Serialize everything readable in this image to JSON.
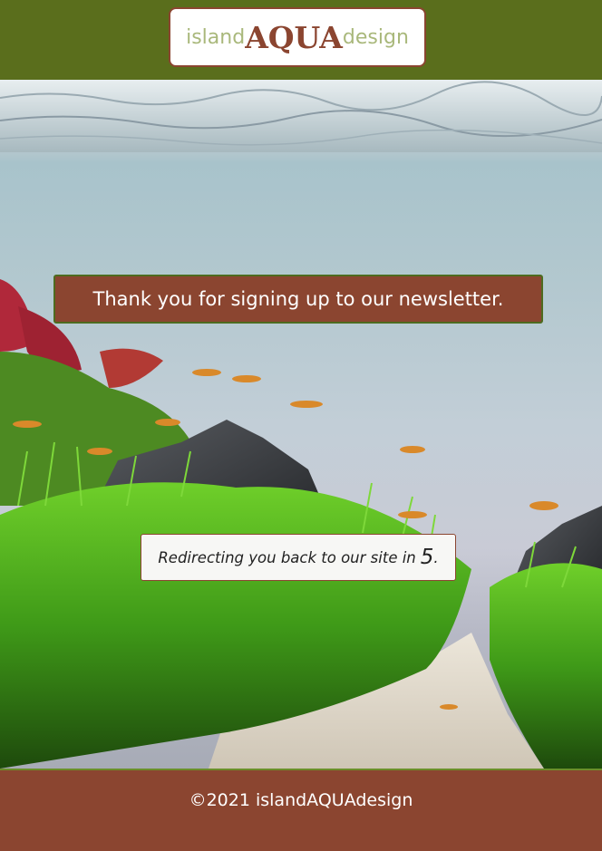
{
  "header": {
    "logo": {
      "prefix": "island",
      "middle": "AQUA",
      "suffix": "design"
    }
  },
  "main": {
    "message": "Thank you for signing up to our newsletter.",
    "redirect_text": "Redirecting you back to our site in",
    "countdown": "5",
    "redirect_suffix": "."
  },
  "footer": {
    "copyright": "©2021 islandAQUAdesign"
  },
  "colors": {
    "brand_green": "#5a6e1c",
    "brand_brown": "#8b4530",
    "logo_light": "#a9b87b"
  }
}
